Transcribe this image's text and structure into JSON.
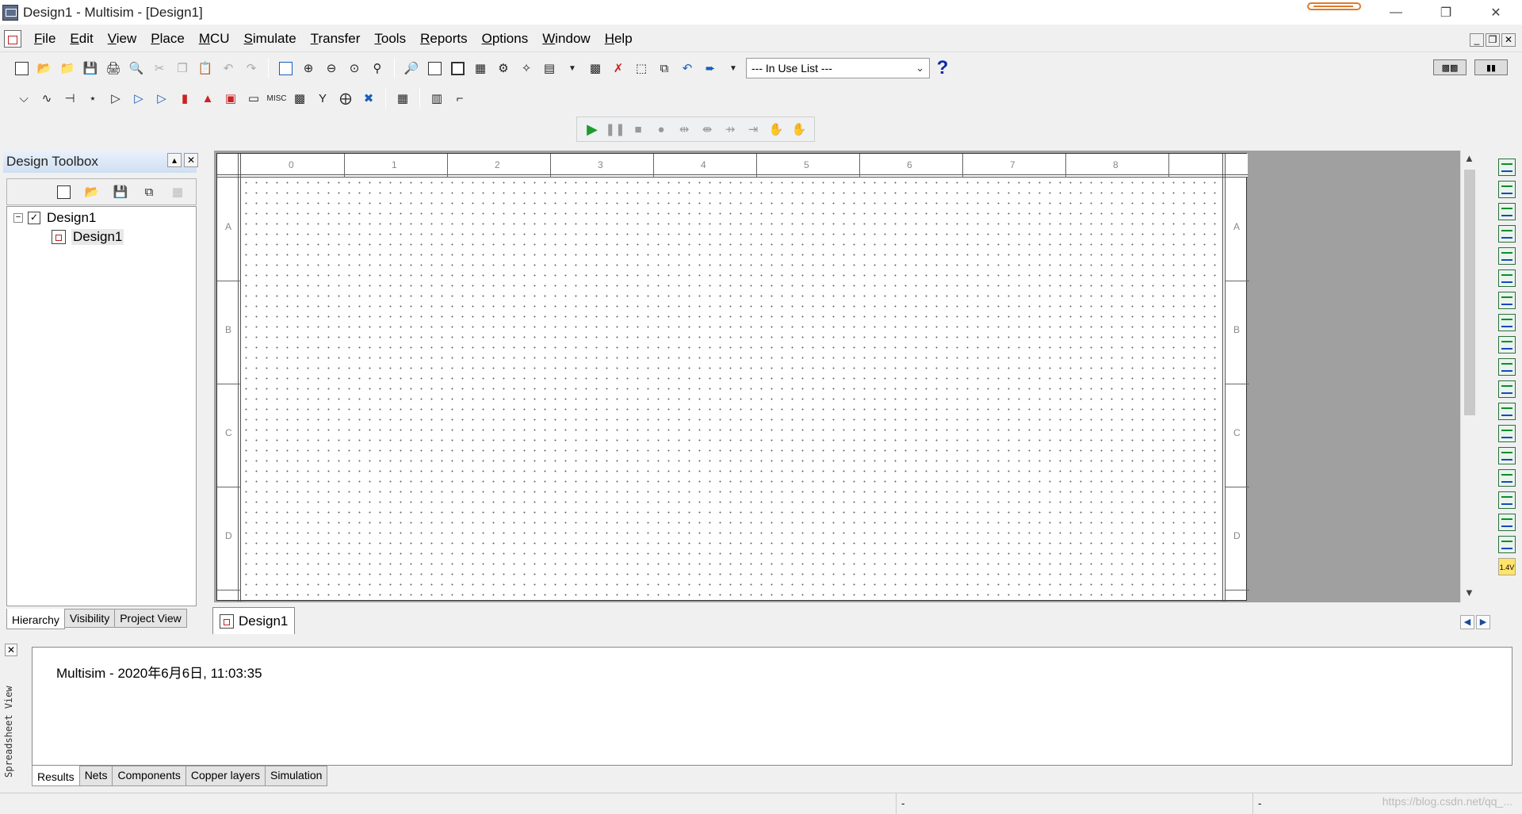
{
  "window": {
    "title": "Design1 - Multisim - [Design1]",
    "controls": [
      "minimize-icon",
      "restore-icon",
      "close-icon"
    ]
  },
  "menu": {
    "items": [
      "File",
      "Edit",
      "View",
      "Place",
      "MCU",
      "Simulate",
      "Transfer",
      "Tools",
      "Reports",
      "Options",
      "Window",
      "Help"
    ]
  },
  "toolbar": {
    "in_use_list": "--- In Use List ---",
    "help_glyph": "?"
  },
  "toolbox": {
    "title": "Design Toolbox",
    "tree": {
      "root": "Design1",
      "child": "Design1"
    },
    "tabs": [
      "Hierarchy",
      "Visibility",
      "Project View"
    ]
  },
  "canvas": {
    "columns": [
      "0",
      "1",
      "2",
      "3",
      "4",
      "5",
      "6",
      "7",
      "8"
    ],
    "rows": [
      "A",
      "B",
      "C",
      "D"
    ],
    "doc_tab": "Design1"
  },
  "spreadsheet": {
    "title": "Spreadsheet View",
    "result_line": "Multisim  -  2020年6月6日, 11:03:35",
    "tabs": [
      "Results",
      "Nets",
      "Components",
      "Copper layers",
      "Simulation"
    ]
  },
  "statusbar": {
    "cell_1": "-",
    "cell_2": "-",
    "watermark": "https://blog.csdn.net/qq_... "
  },
  "colors": {
    "sim_run": "#1f9a2e",
    "help_blue": "#0a2aa8",
    "accent_orange": "#e07a2e"
  }
}
